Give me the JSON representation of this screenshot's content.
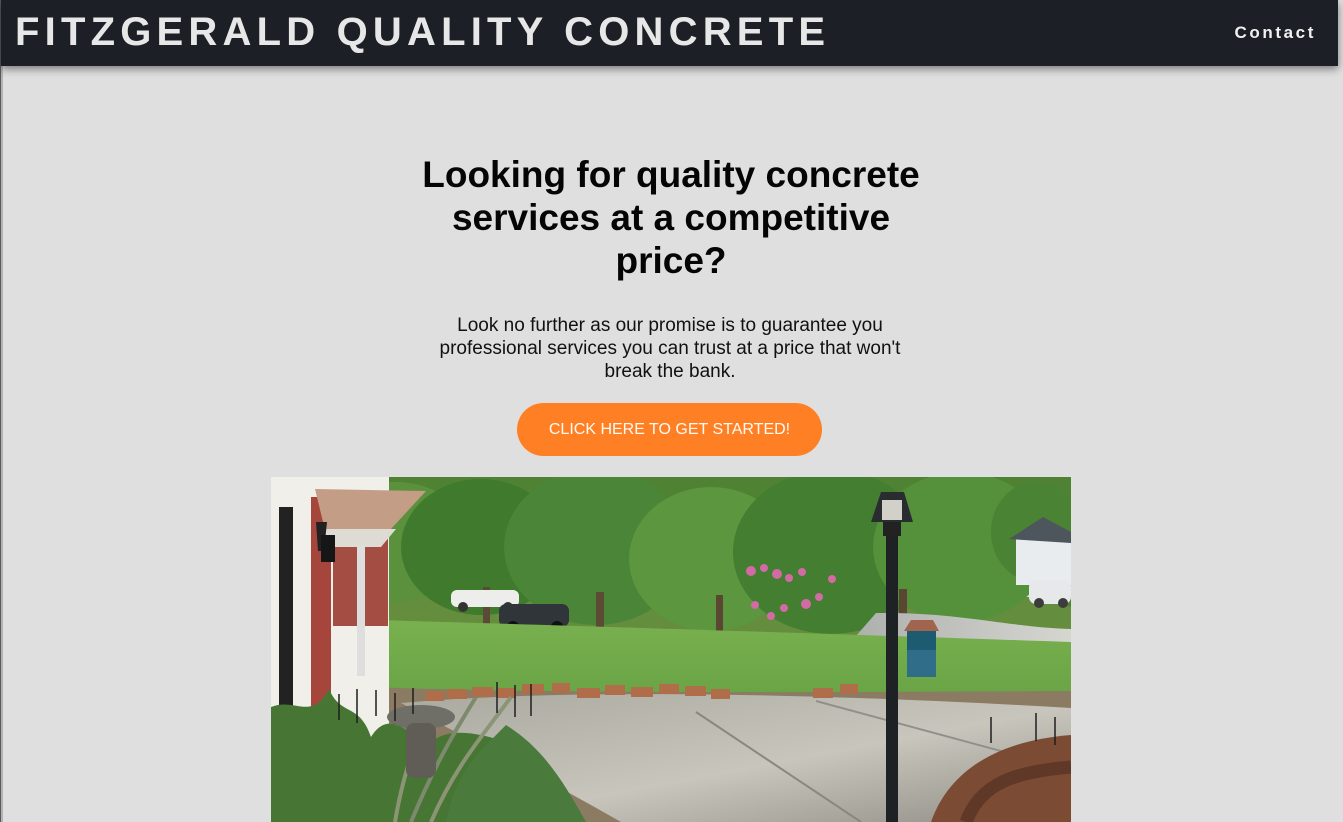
{
  "site": {
    "brand_name": "FITZGERALD QUALITY CONCRETE",
    "nav": {
      "contact_label": "Contact"
    }
  },
  "hero": {
    "headline": "Looking for quality concrete services at a competitive price?",
    "description": "Look no further as our promise is to guarantee you professional services you can trust at a price that won't break the bank.",
    "cta_label": "CLICK HERE TO GET STARTED!"
  },
  "colors": {
    "header_background": "#1c1f26",
    "page_background": "#dfdfdf",
    "cta_background": "#ff8024",
    "cta_text": "#fffaf4"
  },
  "image": {
    "subject": "new concrete driveway with lamp post, brick edging, trees and lawn"
  }
}
